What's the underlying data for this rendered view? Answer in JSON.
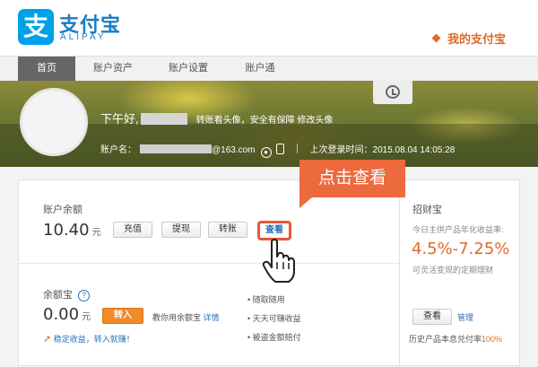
{
  "header": {
    "logo_cn": "支付宝",
    "logo_en": "ALIPAY",
    "logo_mark": "支",
    "my_alipay": "我的支付宝"
  },
  "nav": {
    "items": [
      {
        "label": "首页",
        "active": true
      },
      {
        "label": "账户资产",
        "active": false
      },
      {
        "label": "账户设置",
        "active": false
      },
      {
        "label": "账户通",
        "active": false
      }
    ]
  },
  "profile": {
    "greeting": "下午好,",
    "avatar_tip": "转账看头像，安全有保障 修改头像",
    "account_label": "账户名：",
    "account_suffix": "@163.com",
    "last_login": "上次登录时间：2015.08.04 14:05:28"
  },
  "balance": {
    "label": "账户余额",
    "amount": "10.40",
    "unit": "元",
    "buttons": [
      "充值",
      "提现",
      "转账",
      "查看"
    ]
  },
  "callout": {
    "text": "点击查看"
  },
  "yuebao": {
    "label": "余额宝",
    "help_icon": "?",
    "amount": "0.00",
    "unit": "元",
    "transfer_in": "转入",
    "tutorial": "教你用余额宝",
    "details": "详情",
    "promo": "稳定收益，转入就赚！",
    "features": [
      "随取随用",
      "天天可赚收益",
      "被盗金额赔付"
    ]
  },
  "zhaocai": {
    "label": "招财宝",
    "rate_label": "今日主供产品年化收益率:",
    "rate": "4.5%-7.25%",
    "desc": "可灵活变现的定期理财",
    "view_btn": "查看",
    "manage": "管理",
    "history_prefix": "历史产品本息兑付率",
    "history_rate": "100%"
  },
  "colors": {
    "brand_blue": "#00a0e9",
    "accent_orange": "#e06a2a",
    "callout": "#ec6a3d",
    "link": "#2a6fb8"
  }
}
